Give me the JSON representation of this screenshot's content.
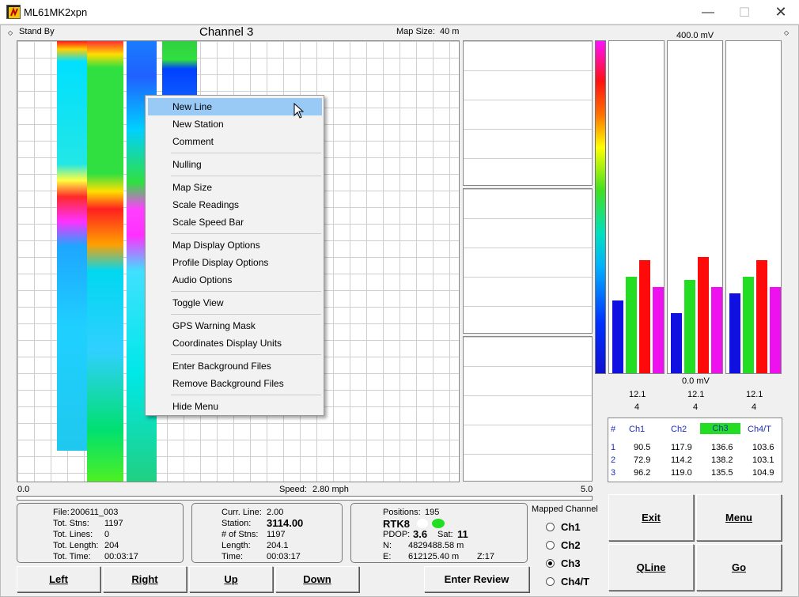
{
  "window": {
    "title": "ML61MK2xpn"
  },
  "header": {
    "status": "Stand By",
    "channel": "Channel 3",
    "map_size_label": "Map Size:",
    "map_size_value": "40 m",
    "bar_top_value": "400.0 mV"
  },
  "map_footer": {
    "left": "0.0",
    "speed_label": "Speed:",
    "speed_value": "2.80 mph",
    "right": "5.0"
  },
  "context_menu": {
    "items": [
      "New Line",
      "New Station",
      "Comment",
      "Nulling",
      "Map Size",
      "Scale Readings",
      "Scale Speed Bar",
      "Map Display Options",
      "Profile Display Options",
      "Audio Options",
      "Toggle View",
      "GPS Warning Mask",
      "Coordinates Display Units",
      "Enter Background Files",
      "Remove Background Files",
      "Hide Menu"
    ],
    "highlighted": "New Line"
  },
  "bar_panel": {
    "zero_label": "0.0 mV",
    "scale_range_mv": [
      0,
      400
    ],
    "columns": [
      {
        "top": "12.1",
        "bottom": "4",
        "values": [
          0.22,
          0.29,
          0.34,
          0.26
        ]
      },
      {
        "top": "12.1",
        "bottom": "4",
        "values": [
          0.18,
          0.28,
          0.35,
          0.26
        ]
      },
      {
        "top": "12.1",
        "bottom": "4",
        "values": [
          0.24,
          0.29,
          0.34,
          0.26
        ]
      }
    ],
    "bar_colors": [
      "#1010e0",
      "#22dd22",
      "#ff0a0a",
      "#ee10ee"
    ]
  },
  "readings_table": {
    "headers": [
      "#",
      "Ch1",
      "Ch2",
      "Ch3",
      "Ch4/T"
    ],
    "selected_header": "Ch3",
    "selected_color": "#22dd22",
    "rows": [
      [
        "1",
        "90.5",
        "117.9",
        "136.6",
        "103.6"
      ],
      [
        "2",
        "72.9",
        "114.2",
        "138.2",
        "103.1"
      ],
      [
        "3",
        "96.2",
        "119.0",
        "135.5",
        "104.9"
      ]
    ]
  },
  "file_info": {
    "file_label": "File:",
    "file_value": "200611_003",
    "stns_label": "Tot. Stns:",
    "stns_value": "1197",
    "lines_label": "Tot. Lines:",
    "lines_value": "0",
    "length_label": "Tot. Length:",
    "length_value": "204",
    "time_label": "Tot. Time:",
    "time_value": "00:03:17"
  },
  "line_info": {
    "line_label": "Curr. Line:",
    "line_value": "2.00",
    "station_label": "Station:",
    "station_value": "3114.00",
    "nstns_label": "# of Stns:",
    "nstns_value": "1197",
    "length_label": "Length:",
    "length_value": "204.1",
    "time_label": "Time:",
    "time_value": "00:03:17"
  },
  "gps_info": {
    "positions_label": "Positions:",
    "positions_value": "195",
    "mode": "RTK8",
    "pdop_label": "PDOP:",
    "pdop_value": "3.6",
    "sat_label": "Sat:",
    "sat_value": "11",
    "n_label": "N:",
    "n_value": "4829488.58 m",
    "e_label": "E:",
    "e_value": "612125.40 m",
    "z_label": "Z:17"
  },
  "mapped_channel": {
    "label": "Mapped Channel",
    "options": [
      "Ch1",
      "Ch2",
      "Ch3",
      "Ch4/T"
    ],
    "selected": "Ch3"
  },
  "buttons": {
    "left": "Left",
    "right": "Right",
    "up": "Up",
    "down": "Down",
    "enter_review": "Enter Review",
    "exit": "Exit",
    "menu": "Menu",
    "qline": "QLine",
    "go": "Go"
  }
}
